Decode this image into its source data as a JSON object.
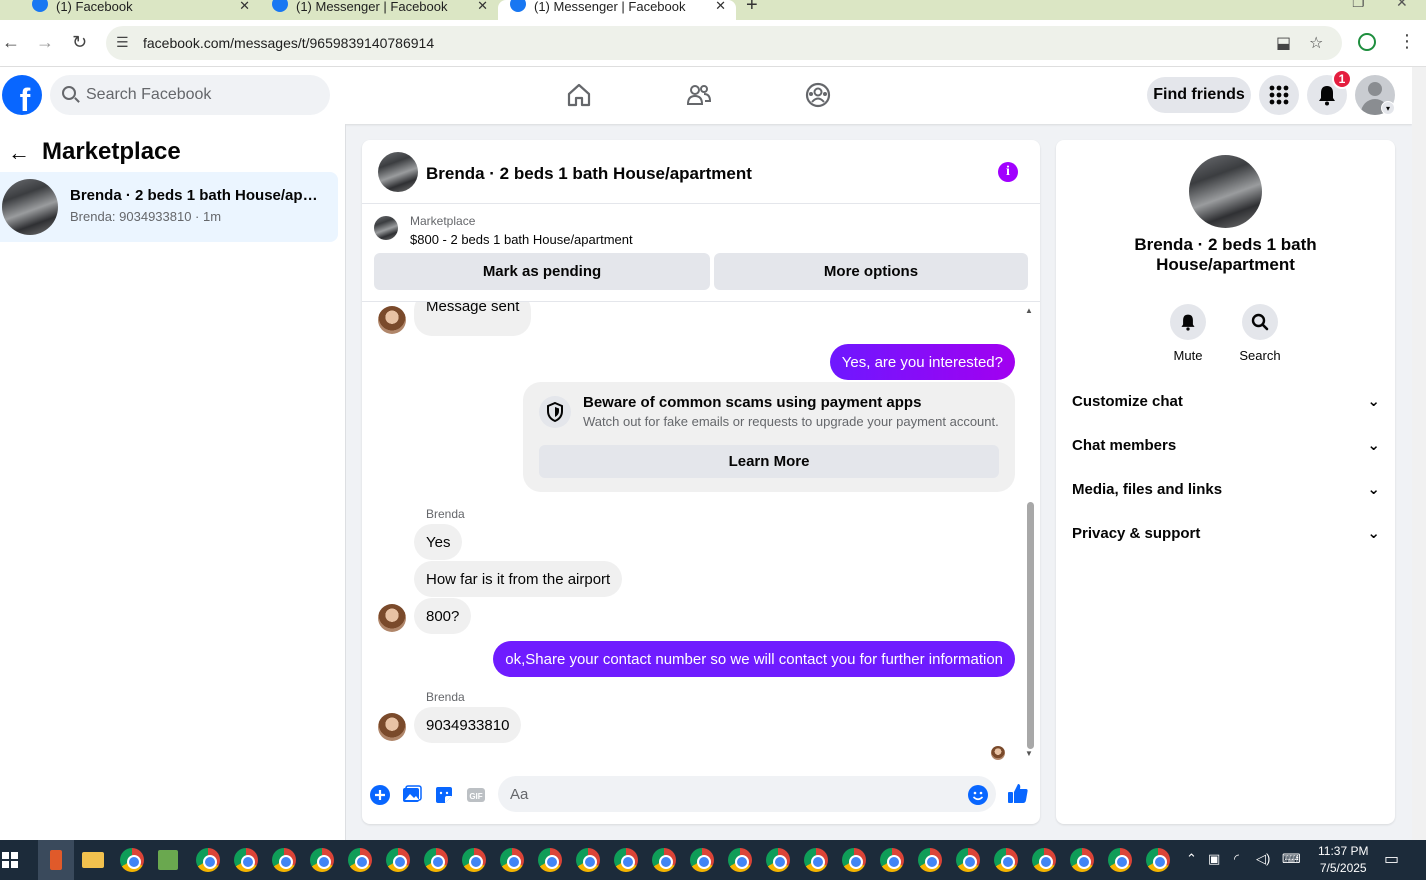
{
  "browser": {
    "tabs": [
      {
        "title": "(1) Facebook"
      },
      {
        "title": "(1) Messenger | Facebook"
      },
      {
        "title": "(1) Messenger | Facebook"
      }
    ],
    "url": "facebook.com/messages/t/9659839140786914"
  },
  "header": {
    "search_placeholder": "Search Facebook",
    "find_friends_label": "Find friends",
    "notification_count": "1"
  },
  "sidebar": {
    "title": "Marketplace",
    "conversation": {
      "name": "Brenda · 2 beds 1 bath House/apartment",
      "preview": "Brenda: 9034933810 · 1m"
    }
  },
  "chat": {
    "title": "Brenda · 2 beds 1 bath House/apartment",
    "listing_source": "Marketplace",
    "listing_info": "$800 - 2 beds 1 bath House/apartment",
    "mark_pending_label": "Mark as pending",
    "more_options_label": "More options",
    "messages": {
      "m1": "Message sent",
      "m2": "Yes, are you interested?",
      "scam_title": "Beware of common scams using payment apps",
      "scam_desc": "Watch out for fake emails or requests to upgrade your payment account.",
      "learn_more": "Learn More",
      "sender1": "Brenda",
      "m3": "Yes",
      "m4": "How far is it from the airport",
      "m5": "800?",
      "m6": "ok,Share your contact number so we will contact you for further information",
      "sender2": "Brenda",
      "m7": "9034933810"
    },
    "composer_placeholder": "Aa"
  },
  "panel": {
    "name": "Brenda · 2 beds 1 bath House/apartment",
    "mute_label": "Mute",
    "search_label": "Search",
    "rows": [
      "Customize chat",
      "Chat members",
      "Media, files and links",
      "Privacy & support"
    ]
  },
  "taskbar": {
    "time": "11:37 PM",
    "date": "7/5/2025"
  },
  "colors": {
    "fb_blue": "#0866ff",
    "message_purple": "#6f1cff",
    "badge_red": "#e41e3f",
    "selected_bg": "#ebf5ff"
  }
}
